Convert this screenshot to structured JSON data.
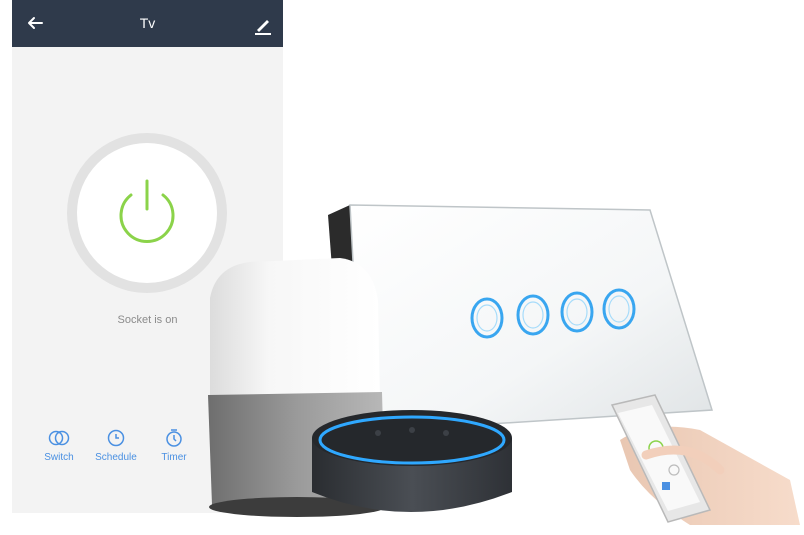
{
  "app": {
    "title": "Tv",
    "back_icon": "arrow-left-icon",
    "edit_icon": "pencil-icon",
    "power_icon": "power-icon",
    "status": "Socket is on",
    "nav": [
      {
        "label": "Switch",
        "icon": "switch-toggle-icon"
      },
      {
        "label": "Schedule",
        "icon": "clock-icon"
      },
      {
        "label": "Timer",
        "icon": "stopwatch-icon"
      }
    ]
  },
  "colors": {
    "header": "#2f3a4b",
    "power_green": "#8bd34a",
    "accent_blue": "#4a90e2",
    "ring_glow": "#39a6f0"
  }
}
